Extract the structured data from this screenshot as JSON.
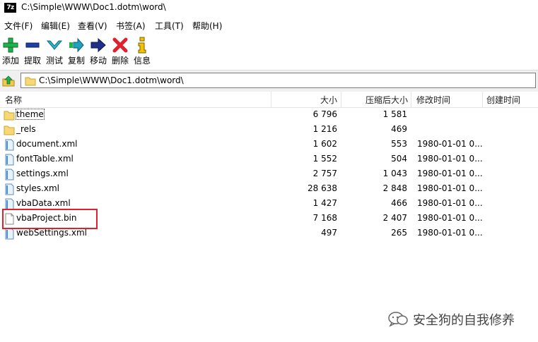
{
  "window": {
    "app_icon_text": "7z",
    "title": "C:\\Simple\\WWW\\Doc1.dotm\\word\\"
  },
  "menu": {
    "items": [
      {
        "label": "文件(F)"
      },
      {
        "label": "编辑(E)"
      },
      {
        "label": "查看(V)"
      },
      {
        "label": "书签(A)"
      },
      {
        "label": "工具(T)"
      },
      {
        "label": "帮助(H)"
      }
    ]
  },
  "toolbar": {
    "buttons": [
      {
        "label": "添加",
        "icon": "plus-icon",
        "color": "#22b14c"
      },
      {
        "label": "提取",
        "icon": "minus-icon",
        "color": "#1f3fa8"
      },
      {
        "label": "测试",
        "icon": "check-icon",
        "color": "#2bb4cf"
      },
      {
        "label": "复制",
        "icon": "copy-arrow-icon",
        "color": "#22a0c0"
      },
      {
        "label": "移动",
        "icon": "move-arrow-icon",
        "color": "#1f2f8a"
      },
      {
        "label": "删除",
        "icon": "delete-x-icon",
        "color": "#e0202a"
      },
      {
        "label": "信息",
        "icon": "info-icon",
        "color": "#f2c300"
      }
    ]
  },
  "address": {
    "path": "C:\\Simple\\WWW\\Doc1.dotm\\word\\"
  },
  "columns": {
    "name": "名称",
    "size": "大小",
    "packed": "压缩后大小",
    "modified": "修改时间",
    "created": "创建时间"
  },
  "files": [
    {
      "name": "theme",
      "type": "folder",
      "size": "6 796",
      "packed": "1 581",
      "modified": ""
    },
    {
      "name": "_rels",
      "type": "folder",
      "size": "1 216",
      "packed": "469",
      "modified": ""
    },
    {
      "name": "document.xml",
      "type": "xml",
      "size": "1 602",
      "packed": "553",
      "modified": "1980-01-01 0..."
    },
    {
      "name": "fontTable.xml",
      "type": "xml",
      "size": "1 552",
      "packed": "504",
      "modified": "1980-01-01 0..."
    },
    {
      "name": "settings.xml",
      "type": "xml",
      "size": "2 757",
      "packed": "1 043",
      "modified": "1980-01-01 0..."
    },
    {
      "name": "styles.xml",
      "type": "xml",
      "size": "28 638",
      "packed": "2 848",
      "modified": "1980-01-01 0..."
    },
    {
      "name": "vbaData.xml",
      "type": "xml",
      "size": "1 427",
      "packed": "466",
      "modified": "1980-01-01 0..."
    },
    {
      "name": "vbaProject.bin",
      "type": "bin",
      "size": "7 168",
      "packed": "2 407",
      "modified": "1980-01-01 0..."
    },
    {
      "name": "webSettings.xml",
      "type": "xml",
      "size": "497",
      "packed": "265",
      "modified": "1980-01-01 0..."
    }
  ],
  "annotation": {
    "highlight_color": "#e0202a",
    "highlighted_file": "vbaProject.bin"
  },
  "watermark": {
    "text": "安全狗的自我修养"
  }
}
